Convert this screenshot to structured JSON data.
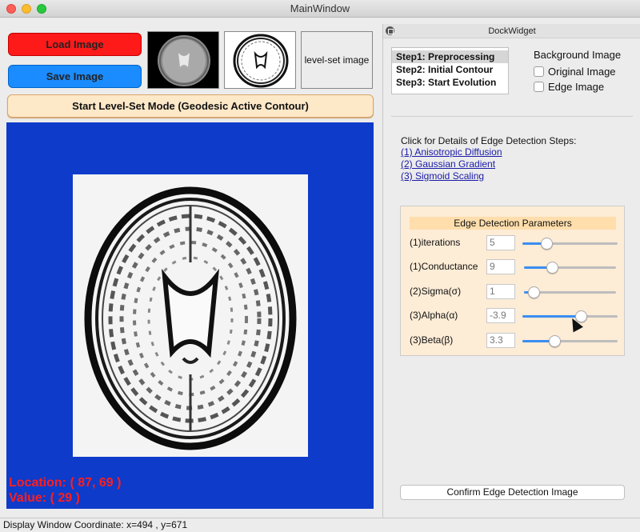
{
  "window": {
    "title": "MainWindow"
  },
  "left": {
    "load_button": "Load Image",
    "save_button": "Save Image",
    "thumb3_label": "level-set image",
    "start_button": "Start Level-Set Mode (Geodesic Active Contour)",
    "location_text": "Location: ( 87, 69 )",
    "value_text": "Value: ( 29 )"
  },
  "dock": {
    "title": "DockWidget",
    "steps": [
      "Step1: Preprocessing",
      "Step2: Initial Contour",
      "Step3: Start Evolution"
    ],
    "background_title": "Background Image",
    "original_label": "Original Image",
    "edge_label": "Edge Image",
    "details_text": "Click for Details of Edge Detection Steps:",
    "links": [
      "(1) Anisotropic Diffusion",
      "(2) Gaussian Gradient",
      "(3) Sigmoid Scaling"
    ],
    "params_title": "Edge Detection Parameters",
    "params": [
      {
        "label": "(1)iterations",
        "value": "5",
        "level": 0.25
      },
      {
        "label": "(1)Conductance",
        "value": "9",
        "level": 0.3
      },
      {
        "label": "(2)Sigma(σ)",
        "value": "1",
        "level": 0.1
      },
      {
        "label": "(3)Alpha(α)",
        "value": "-3.9",
        "level": 0.61
      },
      {
        "label": "(3)Beta(β)",
        "value": "3.3",
        "level": 0.34
      }
    ],
    "confirm_button": "Confirm Edge Detection Image"
  },
  "status": {
    "text": "Display Window Coordinate: x=494 , y=671"
  }
}
